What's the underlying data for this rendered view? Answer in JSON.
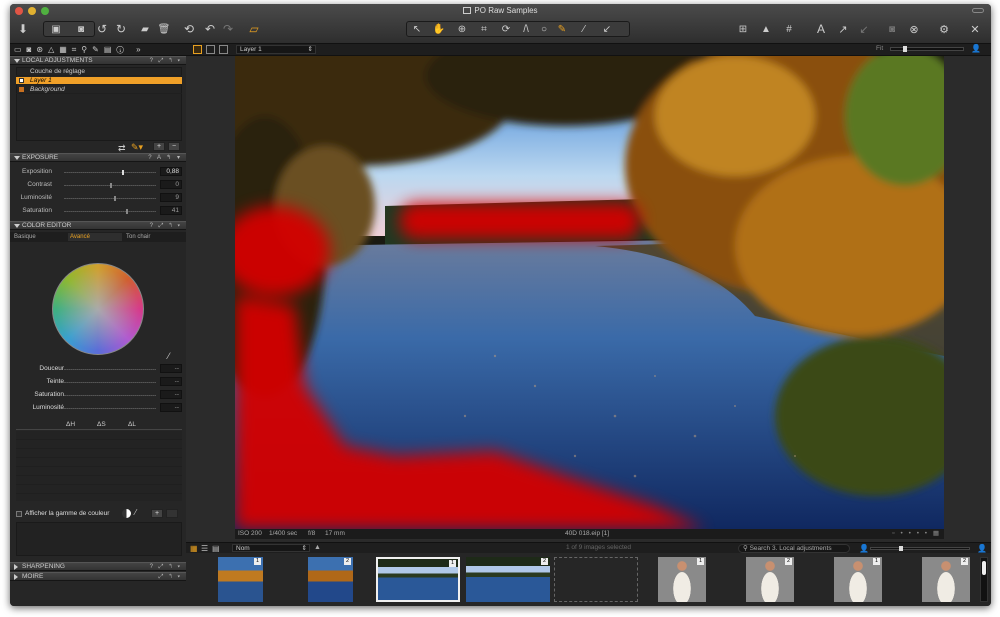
{
  "window": {
    "title": "PO Raw Samples"
  },
  "row2": {
    "layer_select": "Layer 1",
    "fit_label": "Fit"
  },
  "local_adjustments": {
    "header": "LOCAL ADJUSTMENTS",
    "layers_title": "Couche de réglage",
    "layers": [
      {
        "name": "Layer 1",
        "selected": true
      },
      {
        "name": "Background",
        "selected": false
      }
    ],
    "add_label": "+",
    "remove_label": "−"
  },
  "exposure": {
    "header": "EXPOSURE",
    "sliders": [
      {
        "label": "Exposition",
        "value": "0,88"
      },
      {
        "label": "Contrast",
        "value": "0"
      },
      {
        "label": "Luminosité",
        "value": "9"
      },
      {
        "label": "Saturation",
        "value": "41"
      }
    ]
  },
  "color_editor": {
    "header": "COLOR EDITOR",
    "tabs": [
      "Basique",
      "Avancé",
      "Ton chair"
    ],
    "active_tab": "Avancé",
    "sliders": [
      {
        "label": "Douceur",
        "value": "--"
      },
      {
        "label": "Teinte",
        "value": "--"
      },
      {
        "label": "Saturation",
        "value": "--"
      },
      {
        "label": "Luminosité",
        "value": "--"
      }
    ],
    "deltas": [
      "ΔH",
      "ΔS",
      "ΔL"
    ],
    "gamut_label": "Afficher la gamme de couleur",
    "add_label": "+"
  },
  "sharpening": {
    "header": "SHARPENING"
  },
  "moire": {
    "header": "MOIRE"
  },
  "infobar": {
    "iso": "ISO 200",
    "shutter": "1/400 sec",
    "aperture": "f/8",
    "focal": "17 mm",
    "filename": "40D 018.eip [1]"
  },
  "browser": {
    "sort": "Nom",
    "selection_status": "1 of 9 images selected",
    "search_placeholder": "Search 3. Local adjustments"
  },
  "thumbnails": [
    {
      "badge": "1",
      "kind": "lake"
    },
    {
      "badge": "2",
      "kind": "lake"
    },
    {
      "badge": "1",
      "kind": "lake-selected"
    },
    {
      "badge": "2",
      "kind": "lake"
    },
    {
      "badge": "",
      "kind": "empty"
    },
    {
      "badge": "1",
      "kind": "person"
    },
    {
      "badge": "2",
      "kind": "person"
    },
    {
      "badge": "1",
      "kind": "person"
    },
    {
      "badge": "2",
      "kind": "person"
    }
  ],
  "colors": {
    "accent": "#e8a020",
    "selection": "#f0a028",
    "mask_red": "#d40000"
  }
}
